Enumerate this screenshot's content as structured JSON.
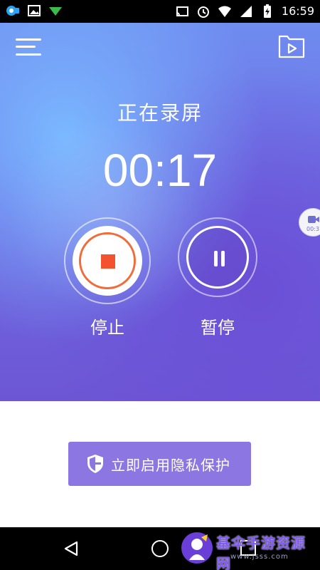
{
  "status_bar": {
    "time": "16:59",
    "left_icons": [
      "screen-record-icon",
      "image-icon",
      "signal-arrow-icon"
    ],
    "right_icons": [
      "cast-icon",
      "alarm-icon",
      "wifi-icon",
      "sim-icon",
      "battery-icon"
    ]
  },
  "header": {
    "menu_icon": "hamburger-menu-icon",
    "folder_icon": "video-folder-icon"
  },
  "recording": {
    "title": "正在录屏",
    "timer": "00:17",
    "stop_label": "停止",
    "pause_label": "暂停"
  },
  "floating_ball": {
    "icon": "camera-icon",
    "text": "00:37"
  },
  "privacy": {
    "label": "立即启用隐私保护",
    "icon": "shield-icon"
  },
  "nav": {
    "back_icon": "back-triangle-icon",
    "home_icon": "home-circle-icon",
    "recent_icon": "recent-square-icon"
  },
  "watermark": {
    "title": "基伞手游资源网",
    "subtitle": "www.jsss.com"
  },
  "colors": {
    "accent_purple": "#8b76e2",
    "stop_red": "#f2532e",
    "gradient_top": "#6f8cf0",
    "gradient_bottom": "#6d56d4"
  }
}
